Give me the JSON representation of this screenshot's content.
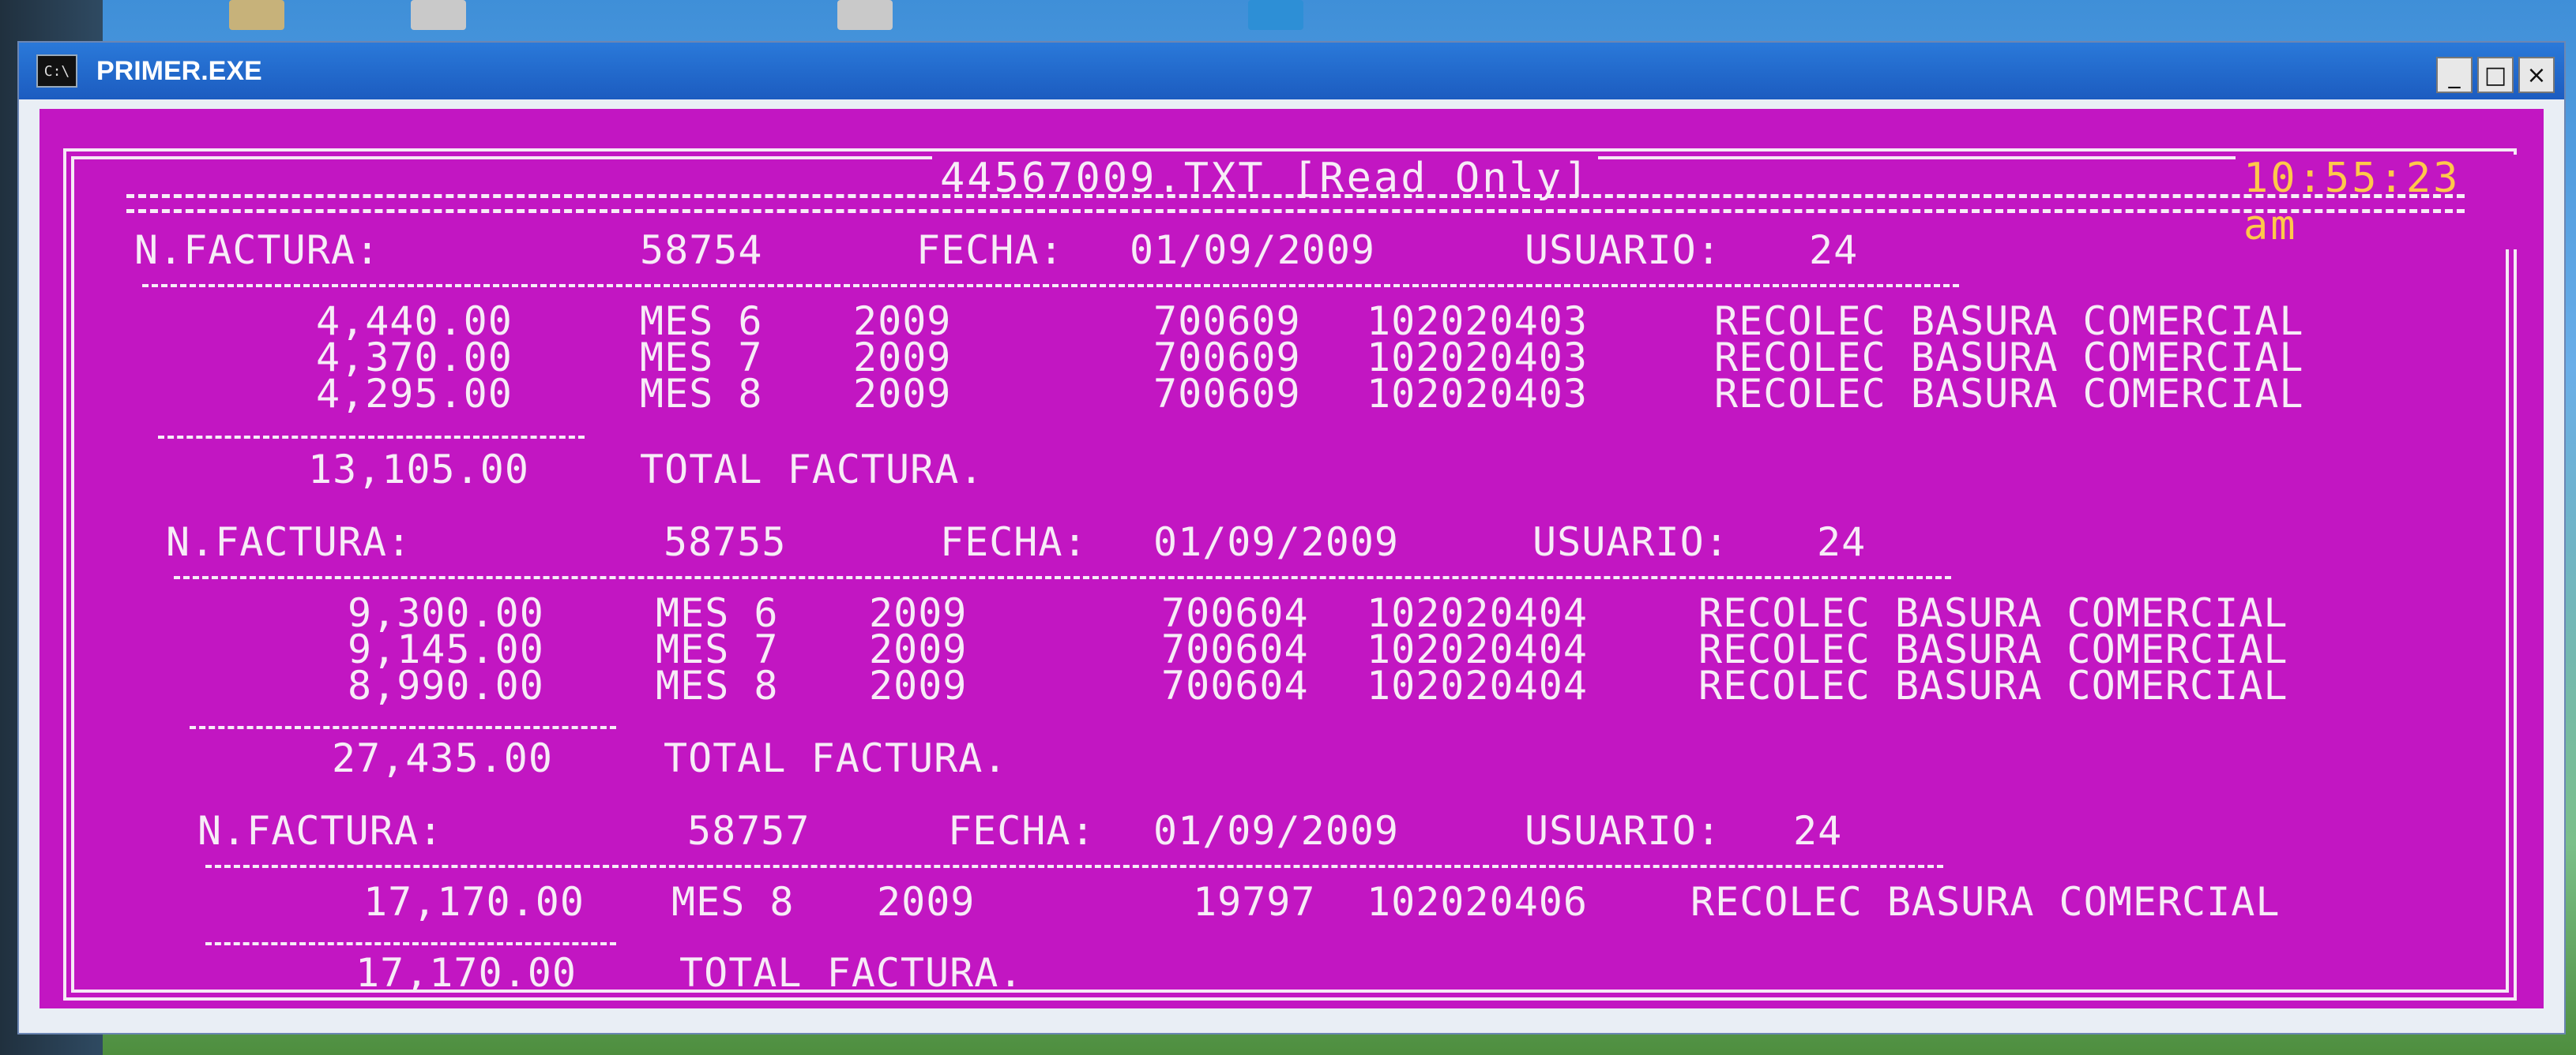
{
  "window": {
    "title": "PRIMER.EXE",
    "icon_label": "C:\\",
    "buttons": {
      "minimize": "_",
      "maximize": "□",
      "close": "×"
    }
  },
  "console": {
    "file_header": "44567009.TXT [Read Only]",
    "clock": "10:55:23 am",
    "labels": {
      "invoice": "N.FACTURA:",
      "date": "FECHA:",
      "user": "USUARIO:",
      "total": "TOTAL FACTURA."
    },
    "invoices": [
      {
        "number": "58754",
        "date": "01/09/2009",
        "user": "24",
        "lines": [
          {
            "amount": "4,440.00",
            "month": "MES 6",
            "year": "2009",
            "code": "700609",
            "account": "102020403",
            "description": "RECOLEC BASURA COMERCIAL"
          },
          {
            "amount": "4,370.00",
            "month": "MES 7",
            "year": "2009",
            "code": "700609",
            "account": "102020403",
            "description": "RECOLEC BASURA COMERCIAL"
          },
          {
            "amount": "4,295.00",
            "month": "MES 8",
            "year": "2009",
            "code": "700609",
            "account": "102020403",
            "description": "RECOLEC BASURA COMERCIAL"
          }
        ],
        "total": "13,105.00"
      },
      {
        "number": "58755",
        "date": "01/09/2009",
        "user": "24",
        "lines": [
          {
            "amount": "9,300.00",
            "month": "MES 6",
            "year": "2009",
            "code": "700604",
            "account": "102020404",
            "description": "RECOLEC BASURA COMERCIAL"
          },
          {
            "amount": "9,145.00",
            "month": "MES 7",
            "year": "2009",
            "code": "700604",
            "account": "102020404",
            "description": "RECOLEC BASURA COMERCIAL"
          },
          {
            "amount": "8,990.00",
            "month": "MES 8",
            "year": "2009",
            "code": "700604",
            "account": "102020404",
            "description": "RECOLEC BASURA COMERCIAL"
          }
        ],
        "total": "27,435.00"
      },
      {
        "number": "58757",
        "date": "01/09/2009",
        "user": "24",
        "lines": [
          {
            "amount": "17,170.00",
            "month": "MES 8",
            "year": "2009",
            "code": "19797",
            "account": "102020406",
            "description": "RECOLEC BASURA COMERCIAL"
          }
        ],
        "total": "17,170.00"
      }
    ]
  },
  "colors": {
    "console_bg": "#c216c2",
    "console_text": "#f7ecf7",
    "clock": "#ffc84a",
    "titlebar": "#1c5cc0"
  }
}
